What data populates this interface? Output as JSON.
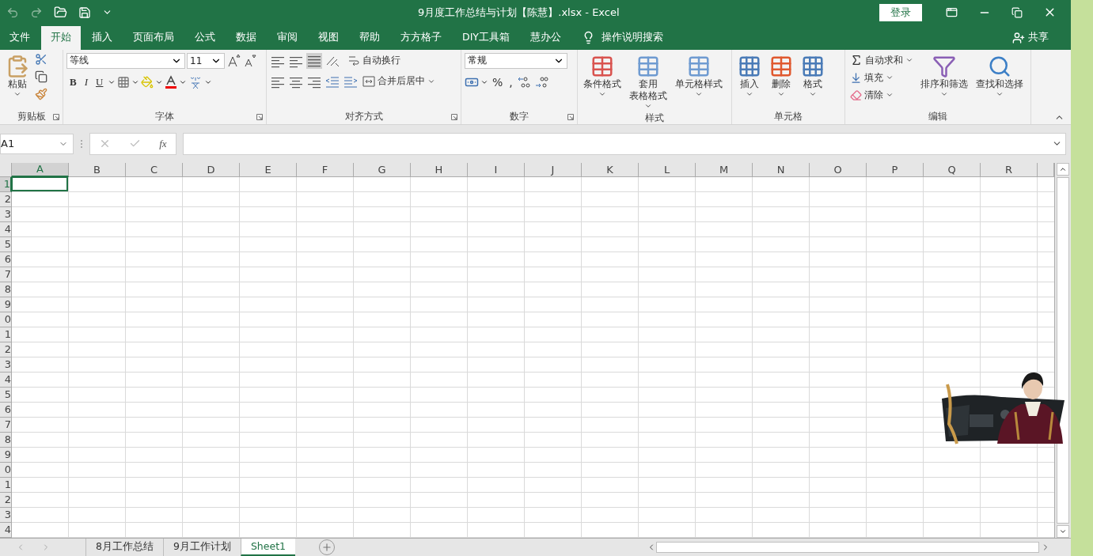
{
  "window": {
    "title": "9月度工作总结与计划【陈慧】.xlsx  -  Excel",
    "login": "登录"
  },
  "ribbon_tabs": [
    {
      "label": "文件",
      "selected": false
    },
    {
      "label": "开始",
      "selected": true
    },
    {
      "label": "插入",
      "selected": false
    },
    {
      "label": "页面布局",
      "selected": false
    },
    {
      "label": "公式",
      "selected": false
    },
    {
      "label": "数据",
      "selected": false
    },
    {
      "label": "审阅",
      "selected": false
    },
    {
      "label": "视图",
      "selected": false
    },
    {
      "label": "帮助",
      "selected": false
    },
    {
      "label": "方方格子",
      "selected": false
    },
    {
      "label": "DIY工具箱",
      "selected": false
    },
    {
      "label": "慧办公",
      "selected": false
    }
  ],
  "tell_me": "操作说明搜索",
  "share": "共享",
  "ribbon": {
    "clipboard": {
      "paste": "粘贴",
      "label": "剪贴板"
    },
    "font": {
      "font_name": "等线",
      "font_size": "11",
      "bold": "B",
      "italic": "I",
      "underline": "U",
      "label": "字体"
    },
    "alignment": {
      "wrap": "自动换行",
      "merge": "合并后居中",
      "label": "对齐方式"
    },
    "number": {
      "format": "常规",
      "percent": "%",
      "comma": ",",
      "label": "数字"
    },
    "styles": {
      "buttons": [
        {
          "lines": [
            "条件格式"
          ]
        },
        {
          "lines": [
            "套用",
            "表格格式"
          ]
        },
        {
          "lines": [
            "单元格样式"
          ]
        }
      ],
      "label": "样式"
    },
    "cells": {
      "buttons": [
        "插入",
        "删除",
        "格式"
      ],
      "label": "单元格"
    },
    "editing": {
      "autosum": "自动求和",
      "fill": "填充",
      "clear": "清除",
      "sort": "排序和筛选",
      "find": "查找和选择",
      "label": "编辑"
    }
  },
  "formula_bar": {
    "name_box": "A1",
    "fx": "fx"
  },
  "grid": {
    "columns": [
      {
        "label": "A",
        "selected": true
      },
      {
        "label": "B",
        "selected": false
      },
      {
        "label": "C",
        "selected": false
      },
      {
        "label": "D",
        "selected": false
      },
      {
        "label": "E",
        "selected": false
      },
      {
        "label": "F",
        "selected": false
      },
      {
        "label": "G",
        "selected": false
      },
      {
        "label": "H",
        "selected": false
      },
      {
        "label": "I",
        "selected": false
      },
      {
        "label": "J",
        "selected": false
      },
      {
        "label": "K",
        "selected": false
      },
      {
        "label": "L",
        "selected": false
      },
      {
        "label": "M",
        "selected": false
      },
      {
        "label": "N",
        "selected": false
      },
      {
        "label": "O",
        "selected": false
      },
      {
        "label": "P",
        "selected": false
      },
      {
        "label": "Q",
        "selected": false
      },
      {
        "label": "R",
        "selected": false
      }
    ],
    "rows": [
      {
        "label": "1",
        "selected": true
      },
      {
        "label": "2",
        "selected": false
      },
      {
        "label": "3",
        "selected": false
      },
      {
        "label": "4",
        "selected": false
      },
      {
        "label": "5",
        "selected": false
      },
      {
        "label": "6",
        "selected": false
      },
      {
        "label": "7",
        "selected": false
      },
      {
        "label": "8",
        "selected": false
      },
      {
        "label": "9",
        "selected": false
      },
      {
        "label": "0",
        "selected": false
      },
      {
        "label": "1",
        "selected": false
      },
      {
        "label": "2",
        "selected": false
      },
      {
        "label": "3",
        "selected": false
      },
      {
        "label": "4",
        "selected": false
      },
      {
        "label": "5",
        "selected": false
      },
      {
        "label": "6",
        "selected": false
      },
      {
        "label": "7",
        "selected": false
      },
      {
        "label": "8",
        "selected": false
      },
      {
        "label": "9",
        "selected": false
      },
      {
        "label": "0",
        "selected": false
      },
      {
        "label": "1",
        "selected": false
      },
      {
        "label": "2",
        "selected": false
      },
      {
        "label": "3",
        "selected": false
      },
      {
        "label": "4",
        "selected": false
      }
    ]
  },
  "sheet_tabs": [
    {
      "label": "8月工作总结",
      "selected": false
    },
    {
      "label": "9月工作计划",
      "selected": false
    },
    {
      "label": "Sheet1",
      "selected": true
    }
  ]
}
